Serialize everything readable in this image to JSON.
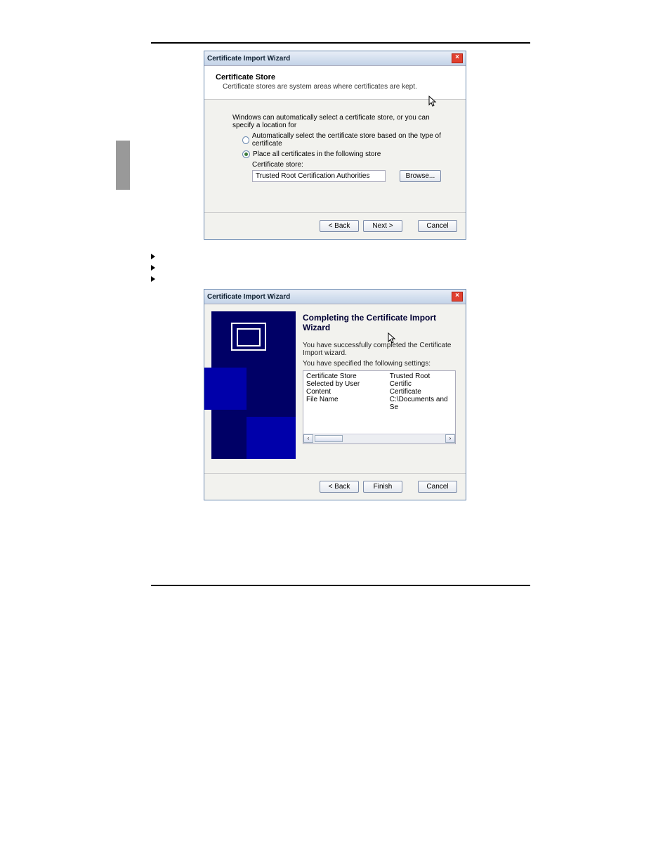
{
  "dialog1": {
    "title": "Certificate Import Wizard",
    "header_title": "Certificate Store",
    "header_desc": "Certificate stores are system areas where certificates are kept.",
    "intro_text": "Windows can automatically select a certificate store, or you can specify a location for",
    "radio_auto": "Automatically select the certificate store based on the type of certificate",
    "radio_place": "Place all certificates in the following store",
    "store_label": "Certificate store:",
    "store_value": "Trusted Root Certification Authorities",
    "browse_label": "Browse...",
    "back_label": "< Back",
    "next_label": "Next >",
    "cancel_label": "Cancel"
  },
  "dialog2": {
    "title": "Certificate Import Wizard",
    "header_title": "Completing the Certificate Import Wizard",
    "success_text": "You have successfully completed the Certificate Import wizard.",
    "settings_intro": "You have specified the following settings:",
    "rows": [
      {
        "k": "Certificate Store Selected by User",
        "v": "Trusted Root Certific"
      },
      {
        "k": "Content",
        "v": "Certificate"
      },
      {
        "k": "File Name",
        "v": "C:\\Documents and Se"
      }
    ],
    "back_label": "< Back",
    "finish_label": "Finish",
    "cancel_label": "Cancel"
  }
}
